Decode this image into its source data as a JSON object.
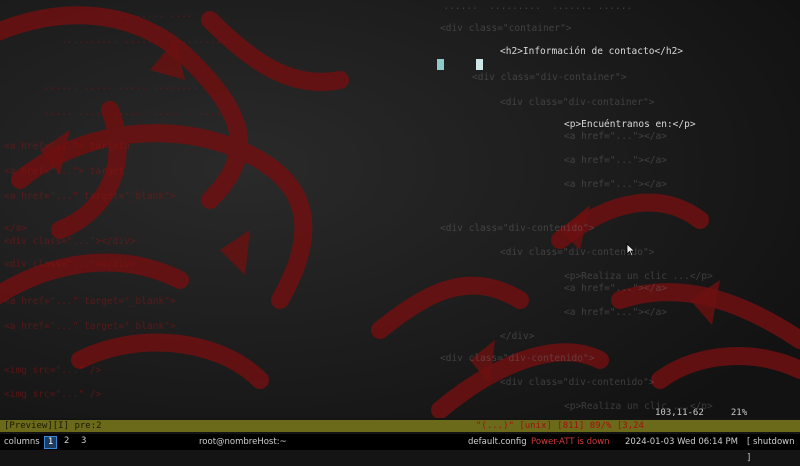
{
  "editor": {
    "right_lines": [
      "<div class=\"container\">",
      "<h2>Información de contacto</h2>",
      "<div class=\"div-container\">",
      "<p>Encuéntranos en:</p>",
      "<a href=\"...\"></a>",
      "<a href=\"...\"></a>",
      "<a href=\"...\"></a>",
      "<div class=\"div-container\">",
      "<div class=\"div-contenido\">",
      "<p>Realiza un clic ...</p>",
      "<a href=\"...\"></a>",
      "<a href=\"...\"></a>",
      "</div>",
      "<div class=\"div-contenido\">",
      "<div class=\"div-contenido\">",
      "<p>Realiza un clic ...</p>"
    ],
    "left_lines": [
      "<a href=\"...\"> tarjeta",
      "<a href=\"...\"> target",
      "<a href=\"...\" target=\"_blank\">",
      "<a href=\"...\" target=\"_blank\">",
      "</a>",
      "</div>",
      "<div class=\"...\"></div>",
      "<div class=\"...\"></div>",
      "<img src=\"...\" />",
      "<img src=\"...\" />"
    ],
    "vim_position": "103,11-62",
    "vim_percent": "21%"
  },
  "vim_status": {
    "left": "[Preview][I]  pre:2",
    "right": "\"(...)\" [unix]  [811] 89/%  [3,24"
  },
  "taskbar": {
    "mode": "columns",
    "workspaces": [
      "1",
      "2",
      "3"
    ],
    "active_workspace": "1",
    "window_title": "root@nombreHost:~",
    "config": "default.config",
    "status": "Power-ATT is down",
    "datetime": "2024-01-03 Wed 06:14 PM",
    "shutdown": "[ shutdown ]"
  },
  "colors": {
    "background": "#141414",
    "wallpaper_red": "#7a1212",
    "vim_status_bg": "#6b6a1b",
    "bar_bg": "#000000",
    "accent_blue": "#3a86d8"
  }
}
